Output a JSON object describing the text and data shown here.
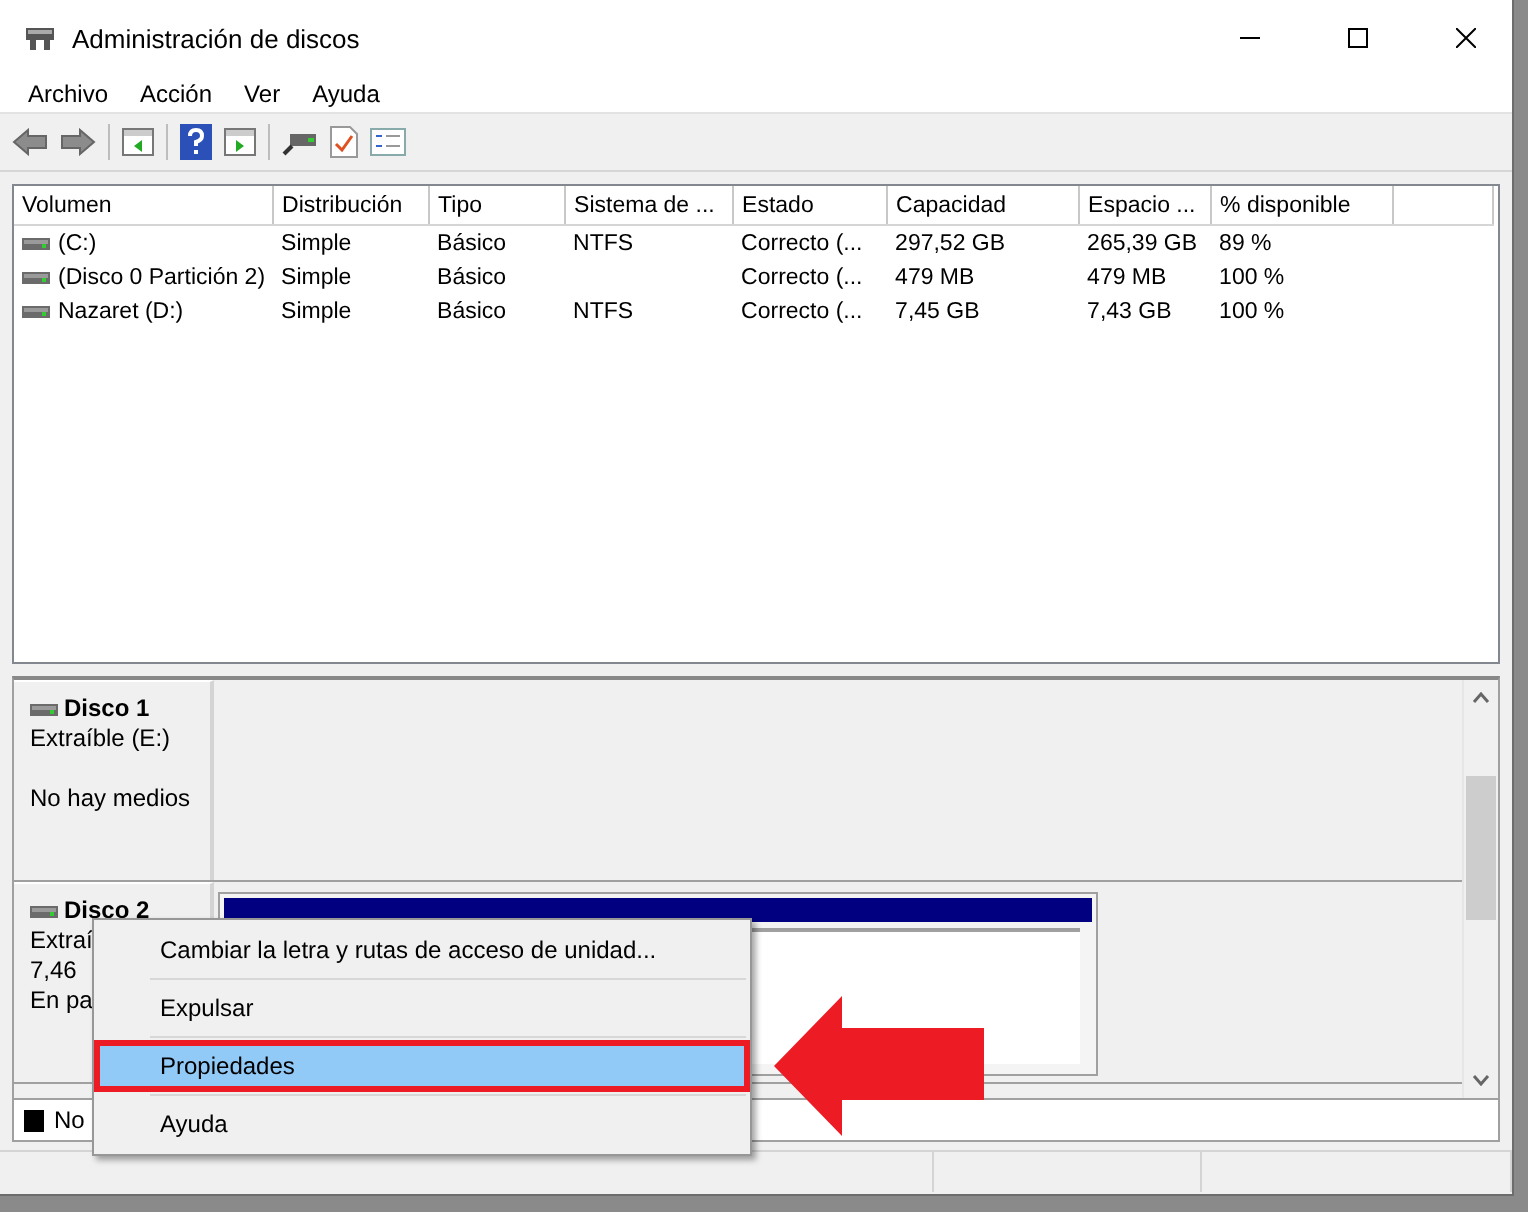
{
  "window": {
    "title": "Administración de discos"
  },
  "menu_bar": [
    "Archivo",
    "Acción",
    "Ver",
    "Ayuda"
  ],
  "volume_table": {
    "columns": [
      "Volumen",
      "Distribución",
      "Tipo",
      "Sistema de ...",
      "Estado",
      "Capacidad",
      "Espacio ...",
      "% disponible"
    ],
    "rows": [
      {
        "cells": [
          "(C:)",
          "Simple",
          "Básico",
          "NTFS",
          "Correcto (...",
          "297,52 GB",
          "265,39 GB",
          "89 %"
        ]
      },
      {
        "cells": [
          "(Disco 0 Partición 2)",
          "Simple",
          "Básico",
          "",
          "Correcto (...",
          "479 MB",
          "479 MB",
          "100 %"
        ]
      },
      {
        "cells": [
          "Nazaret (D:)",
          "Simple",
          "Básico",
          "NTFS",
          "Correcto (...",
          "7,45 GB",
          "7,43 GB",
          "100 %"
        ]
      }
    ]
  },
  "disks": [
    {
      "name": "Disco 1",
      "type": "Extraíble (E:)",
      "status": "No hay medios",
      "partition": false
    },
    {
      "name": "Disco 2",
      "type": "Extraí",
      "size": "7,46",
      "status": "En pa",
      "partition": true
    }
  ],
  "legend": [
    "No"
  ],
  "context_menu": [
    {
      "label": "Cambiar la letra y rutas de acceso de unidad...",
      "selected": false
    },
    {
      "label": "Expulsar",
      "selected": false
    },
    {
      "label": "Propiedades",
      "selected": true
    },
    {
      "label": "Ayuda",
      "selected": false
    }
  ]
}
